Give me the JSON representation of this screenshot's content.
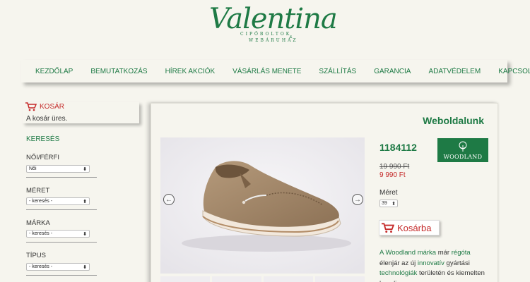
{
  "logo": {
    "script": "Valentina",
    "sub1": "CIPŐBOLTOK",
    "sub2": "WEBÁRUHÁZ",
    "amp": "&",
    "brand_color": "#1e7a45"
  },
  "nav": {
    "items": [
      {
        "label": "KEZDŐLAP"
      },
      {
        "label": "BEMUTATKOZÁS"
      },
      {
        "label": "HÍREK AKCIÓK"
      },
      {
        "label": "VÁSÁRLÁS MENETE"
      },
      {
        "label": "SZÁLLÍTÁS"
      },
      {
        "label": "GARANCIA"
      },
      {
        "label": "ADATVÉDELEM"
      },
      {
        "label": "KAPCSOLAT"
      }
    ]
  },
  "sidebar": {
    "cart_title": "KOSÁR",
    "cart_icon": "cart-icon",
    "cart_empty": "A kosár üres.",
    "search_title": "KERESÉS",
    "filters": [
      {
        "label": "NŐI/FÉRFI",
        "value": "Női"
      },
      {
        "label": "MÉRET",
        "value": "- keresés -"
      },
      {
        "label": "MÁRKA",
        "value": "- keresés -"
      },
      {
        "label": "TÍPUS",
        "value": "- keresés -"
      }
    ]
  },
  "main": {
    "title": "Weboldalunk",
    "product": {
      "code": "1184112",
      "brand": "WOODLAND",
      "old_price": "19 990 Ft",
      "new_price": "9 990 Ft",
      "size_label": "Méret",
      "size_value": "39",
      "buy_label": "Kosárba"
    },
    "description": {
      "p1": "A Woodland márka",
      "p2": "már",
      "p3": "régóta",
      "p4": "élenjár az új",
      "p5": "innovatív",
      "p6": "gyártási",
      "p7": "technológiák",
      "p8": "területén és",
      "p9": "kiemelten kezeli a"
    }
  },
  "colors": {
    "accent_green": "#1e7a45",
    "accent_red": "#c52a2a",
    "background": "#f6f5ee"
  }
}
